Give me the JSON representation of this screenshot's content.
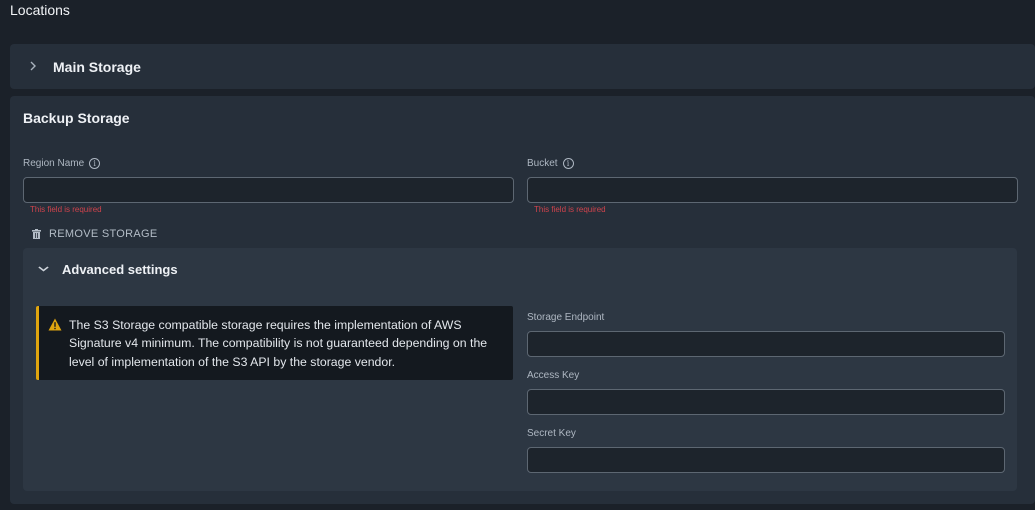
{
  "page": {
    "title": "Locations"
  },
  "main_storage": {
    "label": "Main Storage"
  },
  "backup_storage": {
    "title": "Backup Storage",
    "region_name": {
      "label": "Region Name",
      "value": "",
      "placeholder": "",
      "error": "This field is required"
    },
    "bucket": {
      "label": "Bucket",
      "value": "",
      "placeholder": "",
      "error": "This field is required"
    },
    "remove_label": "REMOVE STORAGE"
  },
  "advanced_settings": {
    "title": "Advanced settings",
    "warning_text": "The S3 Storage compatible storage requires the implementation of AWS Signature v4 minimum. The compatibility is not guaranteed depending on the level of implementation of the S3 API by the storage vendor.",
    "storage_endpoint": {
      "label": "Storage Endpoint",
      "value": ""
    },
    "access_key": {
      "label": "Access Key",
      "value": ""
    },
    "secret_key": {
      "label": "Secret Key",
      "value": ""
    }
  },
  "icons": {
    "info": "info-icon",
    "warning": "warning-icon",
    "trash": "trash-icon",
    "chevron_right": "chevron-right-icon",
    "chevron_down": "chevron-down-icon"
  },
  "colors": {
    "background": "#1b2129",
    "panel": "#262f3a",
    "warning_accent": "#e0a50f",
    "error": "#d0434c"
  }
}
